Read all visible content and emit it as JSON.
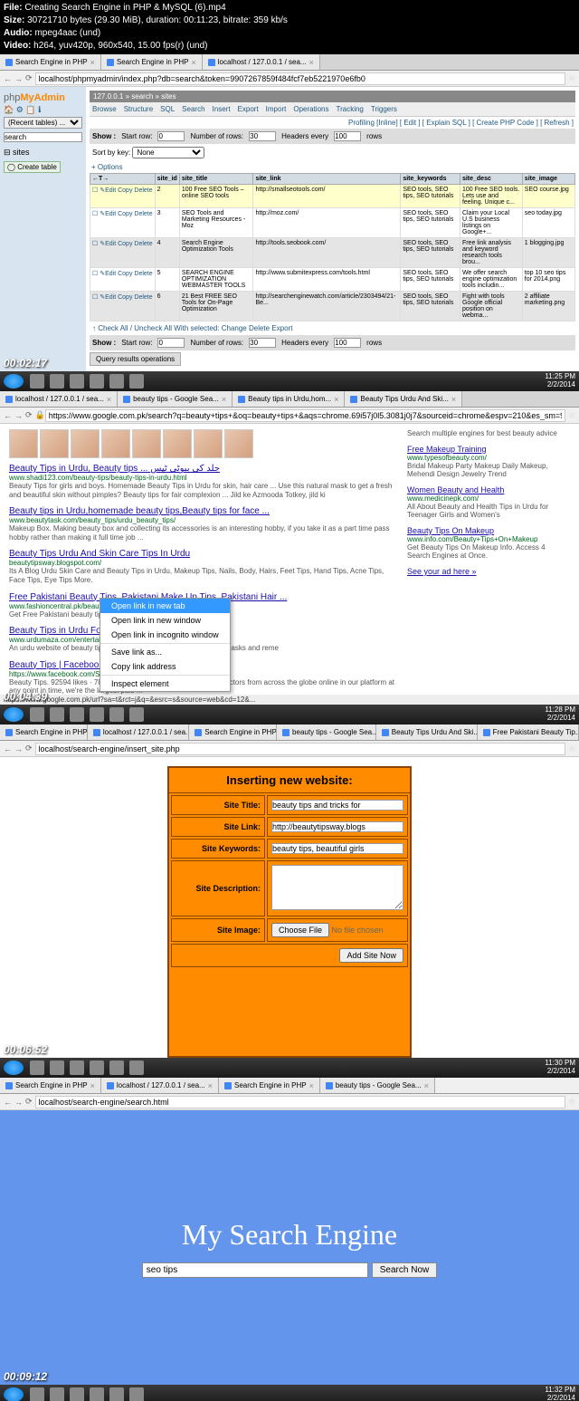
{
  "header": {
    "file": "Creating Search Engine in PHP & MySQL (6).mp4",
    "size": "30721710 bytes (29.30 MiB), duration: 00:11:23, bitrate: 359 kb/s",
    "audio": "mpeg4aac (und)",
    "video": "h264, yuv420p, 960x540, 15.00 fps(r) (und)"
  },
  "s1": {
    "timestamp": "00:02:17",
    "time": "11:25 PM",
    "date": "2/2/2014",
    "tabs": [
      "Search Engine in PHP",
      "Search Engine in PHP",
      "localhost / 127.0.0.1 / sea..."
    ],
    "url": "localhost/phpmyadmin/index.php?db=search&token=9907267859f484fcf7eb5221970e6fb0",
    "logo1": "php",
    "logo2": "MyAdmin",
    "recent": "(Recent tables) ...",
    "search_db": "search",
    "sites": "sites",
    "create": "Create table",
    "crumb": "127.0.0.1 » search » sites",
    "toolbar": [
      "Browse",
      "Structure",
      "SQL",
      "Search",
      "Insert",
      "Export",
      "Import",
      "Operations",
      "Tracking",
      "Triggers"
    ],
    "opts": "Profiling [Inline] [ Edit ] [ Explain SQL ] [ Create PHP Code ] [ Refresh ]",
    "show": "Show :",
    "startrow": "Start row:",
    "sr_val": "0",
    "numrows": "Number of rows:",
    "nr_val": "30",
    "headers": "Headers every",
    "he_val": "100",
    "rows": "rows",
    "sortkey": "Sort by key:",
    "sortval": "None",
    "options": "+ Options",
    "cols": [
      "←T→",
      "site_id",
      "site_title",
      "site_link",
      "site_keywords",
      "site_desc",
      "site_image"
    ],
    "rowact": "Edit  Copy  Delete",
    "data": [
      {
        "id": "2",
        "title": "100 Free SEO Tools – online SEO tools",
        "link": "http://smallseotools.com/",
        "kw": "SEO tools, SEO tips, SEO tutorials",
        "desc": "100 Free SEO tools. Lets use and feeling. Unique c...",
        "img": "SEO course.jpg"
      },
      {
        "id": "3",
        "title": "SEO Tools and Marketing Resources - Moz",
        "link": "http://moz.com/",
        "kw": "SEO tools, SEO tips, SEO tutorials",
        "desc": "Claim your Local U.S business listings on Google+...",
        "img": "seo today.jpg"
      },
      {
        "id": "4",
        "title": "Search Engine Optimization Tools",
        "link": "http://tools.seobook.com/",
        "kw": "SEO tools, SEO tips, SEO tutorials",
        "desc": "Free link analysis and keyword research tools brou...",
        "img": "1 blogging.jpg"
      },
      {
        "id": "5",
        "title": "SEARCH ENGINE OPTIMIZATION WEBMASTER TOOLS",
        "link": "http://www.submitexpress.com/tools.html",
        "kw": "SEO tools, SEO tips, SEO tutorials",
        "desc": "We offer search engine optimization tools includin...",
        "img": "top 10 seo tips for 2014.png"
      },
      {
        "id": "6",
        "title": "21 Best FREE SEO Tools for On-Page Optimization",
        "link": "http://searchenginewatch.com/article/2303494/21-Be...",
        "kw": "SEO tools, SEO tips, SEO tutorials",
        "desc": "Fight with tools Google official position on webma...",
        "img": "2 affiliate marketing.png"
      }
    ],
    "checkall": "Check All / Uncheck All With selected:    Change    Delete    Export",
    "qops": "Query results operations"
  },
  "s2": {
    "timestamp": "00:04:39",
    "time": "11:28 PM",
    "date": "2/2/2014",
    "tabs": [
      "localhost / 127.0.0.1 / sea...",
      "beauty tips - Google Sea...",
      "Beauty tips in Urdu,hom...",
      "Beauty Tips Urdu And Ski..."
    ],
    "url": "https://www.google.com.pk/search?q=beauty+tips+&oq=beauty+tips+&aqs=chrome.69i57j0l5.3081j0j7&sourceid=chrome&espv=210&es_sm=93&ie=UTF-8",
    "ctx": [
      "Open link in new tab",
      "Open link in new window",
      "Open link in incognito window",
      "Save link as...",
      "Copy link address",
      "Inspect element"
    ],
    "side_top": "Search multiple engines for best beauty advice",
    "side1_t": "Free Makeup Training",
    "side1_u": "www.typesofbeauty.com/",
    "side1_d": "Bridal Makeup Party Makeup Daily Makeup, Mehendi Design Jewelry Trend",
    "side2_t": "Women Beauty and Health",
    "side2_u": "www.medicinepk.com/",
    "side2_d": "All About Beauty and Health Tips in Urdu for Teenager Girls and Women's",
    "side3_t": "Beauty Tips On Makeup",
    "side3_u": "www.info.com/Beauty+Tips+On+Makeup",
    "side3_d": "Get Beauty Tips On Makeup Info. Access 4 Search Engines at Once.",
    "seead": "See your ad here »",
    "results": [
      {
        "t": "Beauty Tips in Urdu, Beauty tips ... جلد کی بیوٹی ٹپس",
        "u": "www.shadi123.com/beauty-tips/beauty-tips-in-urdu.html",
        "d": "Beauty Tips for girls and boys. Homemade Beauty Tips in Urdu for skin, hair care ... Use this natural mask to get a fresh and beautiful skin without pimples? Beauty tips for fair complexion ... Jild ke Azmooda Totkey, jild ki"
      },
      {
        "t": "Beauty tips in Urdu,homemade beauty tips,Beauty tips for face ...",
        "u": "www.beautytask.com/beauty_tips/urdu_beauty_tips/",
        "d": "Makeup Box. Making beauty box and collecting its accessories is an interesting hobby, if you take it as a part time pass hobby rather than making it full time job ..."
      },
      {
        "t": "Beauty Tips Urdu And Skin Care Tips In Urdu",
        "u": "beautytipsway.blogspot.com/",
        "d": "Its A Blog Urdu Skin Care and Beauty Tips in Urdu, Makeup Tips, Nails, Body, Hairs, Feet Tips, Hand Tips, Acne Tips, Face Tips, Eye Tips More."
      },
      {
        "t": "Free Pakistani Beauty Tips, Pakistani Make Up Tips, Pakistani Hair ...",
        "u": "www.fashioncentral.pk/beauty-st",
        "d": "Get Free Pakistani beauty tips, m"
      },
      {
        "t": "Beauty Tips in Urdu For Wom",
        "u": "www.urdumaza.com/entertainm",
        "d": "An urdu website of beauty tips for ... late beauty care and skin care masks and reme"
      },
      {
        "t": "Beauty Tips | Facebook",
        "u": "https://www.facebook.com/SkinBeautyTips",
        "d": "Beauty Tips. 92594 likes · 788 talking about this. With around 200 doctors from across the globe online in our platform at any point in time, we're the largest paid ..."
      }
    ],
    "moreresult": "hoauty tine | Facebook",
    "status": "https://www.google.com.pk/url?sa=t&rct=j&q=&esrc=s&source=web&cd=12&..."
  },
  "s3": {
    "timestamp": "00:06:52",
    "time": "11:30 PM",
    "date": "2/2/2014",
    "tabs": [
      "Search Engine in PHP",
      "localhost / 127.0.0.1 / sea...",
      "Search Engine in PHP",
      "beauty tips - Google Sea...",
      "Beauty Tips Urdu And Ski...",
      "Free Pakistani Beauty Tip..."
    ],
    "url": "localhost/search-engine/insert_site.php",
    "title": "Inserting new website:",
    "labels": {
      "st": "Site Title:",
      "sl": "Site Link:",
      "sk": "Site Keywords:",
      "sd": "Site Description:",
      "si": "Site Image:"
    },
    "vals": {
      "st": "beauty tips and tricks for",
      "sl": "http://beautytipsway.blogs",
      "sk": "beauty tips, beautiful girls"
    },
    "choose": "Choose File",
    "nofile": "No file chosen",
    "submit": "Add Site Now"
  },
  "s4": {
    "timestamp": "00:09:12",
    "time": "11:32 PM",
    "date": "2/2/2014",
    "tabs": [
      "Search Engine in PHP",
      "localhost / 127.0.0.1 / sea...",
      "Search Engine in PHP",
      "beauty tips - Google Sea..."
    ],
    "url": "localhost/search-engine/search.html",
    "title": "My Search Engine",
    "query": "seo tips",
    "btn": "Search Now"
  }
}
